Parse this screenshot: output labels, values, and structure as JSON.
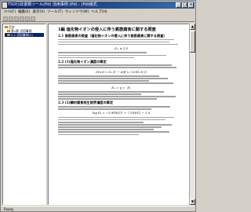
{
  "window": {
    "title": "TSO行政書類ツール(Pd) 活用事例 (Pd) - (Pd)様式",
    "buttons": [
      "_",
      "□",
      "×"
    ]
  },
  "menu": [
    "ﾌｧｲﾙ(F)",
    "編集(E)",
    "表示(V)",
    "ツール(T)",
    "ウィンドウ(W)",
    "ヘルプ(H)"
  ],
  "tree": {
    "items": [
      {
        "label": "目次",
        "level": 0
      },
      {
        "label": "第1節 活用事例",
        "level": 1
      },
      {
        "label": "2.1 活用事例(1)",
        "level": 1,
        "selected": true
      }
    ]
  },
  "doc": {
    "title": "1編 塩化物イオンの侵入に伴う鉄筋腐食に関する照査",
    "sections": [
      {
        "heading": "2.1 鉄筋腐食の照査（塩化物イオンの侵入に伴う鉄筋腐食に関する照査）"
      },
      {
        "heading": "2.2 (1)塩化物イオン濃度の算定"
      },
      {
        "heading": "2.3 (2)鋼材腐食発生限界濃度の算定"
      }
    ],
    "equations": [
      "Ȼₘ ≤ 1.0",
      "Ȼ(x,t) = C₀ (1 − erf( x / 2√(Dₐ·t) ))",
      "Dₐ = γ_c · Dₖ",
      "log Dₖ = −3.9(W/C)² + 7.2(W/C) − 2.5"
    ]
  },
  "status": "Ready"
}
